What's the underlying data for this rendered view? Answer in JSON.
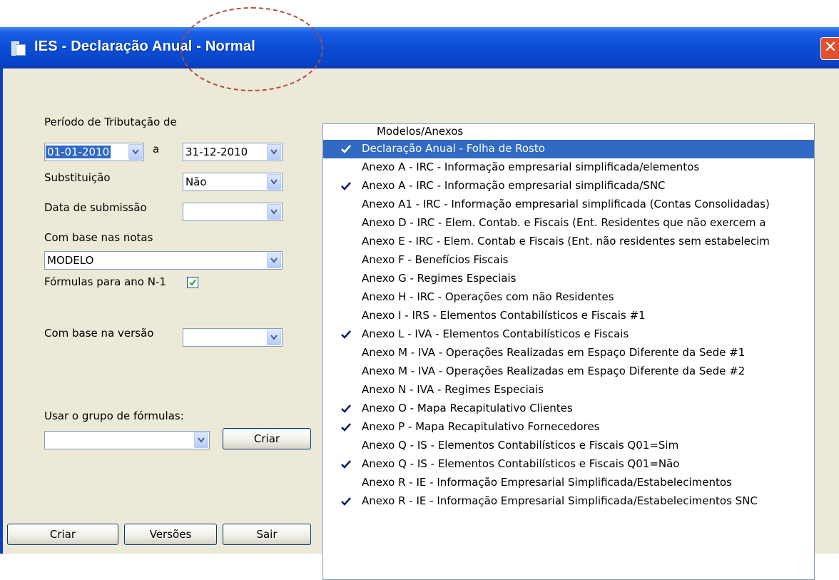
{
  "window": {
    "title": "IES - Declaração Anual - Normal",
    "close_symbol": "✕"
  },
  "form": {
    "periodo_label": "Período de Tributação de",
    "from_date": "01-01-2010",
    "separator": "a",
    "to_date": "31-12-2010",
    "substituicao_label": "Substituição",
    "substituicao_value": "Não",
    "data_submissao_label": "Data de submissão",
    "data_submissao_value": "",
    "com_base_notas_label": "Com base nas notas",
    "com_base_notas_value": "MODELO",
    "formulas_label": "Fórmulas para ano N-1",
    "formulas_checked": true,
    "com_base_versao_label": "Com base na versão",
    "com_base_versao_value": "",
    "grupo_formulas_label": "Usar o grupo de fórmulas:",
    "grupo_formulas_value": "",
    "criar_group_button": "Criar"
  },
  "buttons": {
    "criar": "Criar",
    "versoes": "Versões",
    "sair": "Sair"
  },
  "list": {
    "header": "Modelos/Anexos",
    "items": [
      {
        "label": "Declaração Anual - Folha de Rosto",
        "checked": true,
        "selected": true
      },
      {
        "label": "Anexo A - IRC - Informação empresarial simplificada/elementos",
        "checked": false
      },
      {
        "label": "Anexo A - IRC - Informação empresarial simplificada/SNC",
        "checked": true
      },
      {
        "label": "Anexo A1 - IRC - Informação empresarial simplificada (Contas Consolidadas)",
        "checked": false
      },
      {
        "label": "Anexo D - IRC - Elem. Contab. e Fiscais (Ent. Residentes que não exercem a",
        "checked": false
      },
      {
        "label": "Anexo E - IRC - Elem. Contab e Fiscais (Ent. não residentes sem estabelecim",
        "checked": false
      },
      {
        "label": "Anexo F - Benefícios Fiscais",
        "checked": false
      },
      {
        "label": "Anexo G - Regimes Especiais",
        "checked": false
      },
      {
        "label": "Anexo H - IRC - Operações com não Residentes",
        "checked": false
      },
      {
        "label": "Anexo I - IRS - Elementos Contabilísticos e Fiscais #1",
        "checked": false
      },
      {
        "label": "Anexo L - IVA - Elementos Contabilísticos e Fiscais",
        "checked": true
      },
      {
        "label": "Anexo M - IVA - Operações Realizadas em Espaço Diferente da Sede #1",
        "checked": false
      },
      {
        "label": "Anexo M - IVA - Operações Realizadas em Espaço Diferente da Sede #2",
        "checked": false
      },
      {
        "label": "Anexo N - IVA - Regimes Especiais",
        "checked": false
      },
      {
        "label": "Anexo O - Mapa Recapitulativo Clientes",
        "checked": true
      },
      {
        "label": "Anexo P - Mapa Recapitulativo Fornecedores",
        "checked": true
      },
      {
        "label": "Anexo Q - IS - Elementos Contabilísticos e Fiscais Q01=Sim",
        "checked": false
      },
      {
        "label": "Anexo Q - IS - Elementos Contabilísticos e Fiscais Q01=Não",
        "checked": true
      },
      {
        "label": "Anexo R - IE - Informação Empresarial Simplificada/Estabelecimentos",
        "checked": false
      },
      {
        "label": "Anexo R - IE - Informação Empresarial Simplificada/Estabelecimentos SNC",
        "checked": true
      }
    ]
  },
  "colors": {
    "titlebar": "#0b4ed6",
    "face": "#ece9d8",
    "selection": "#316ac5",
    "annotation": "#b34a3e"
  }
}
